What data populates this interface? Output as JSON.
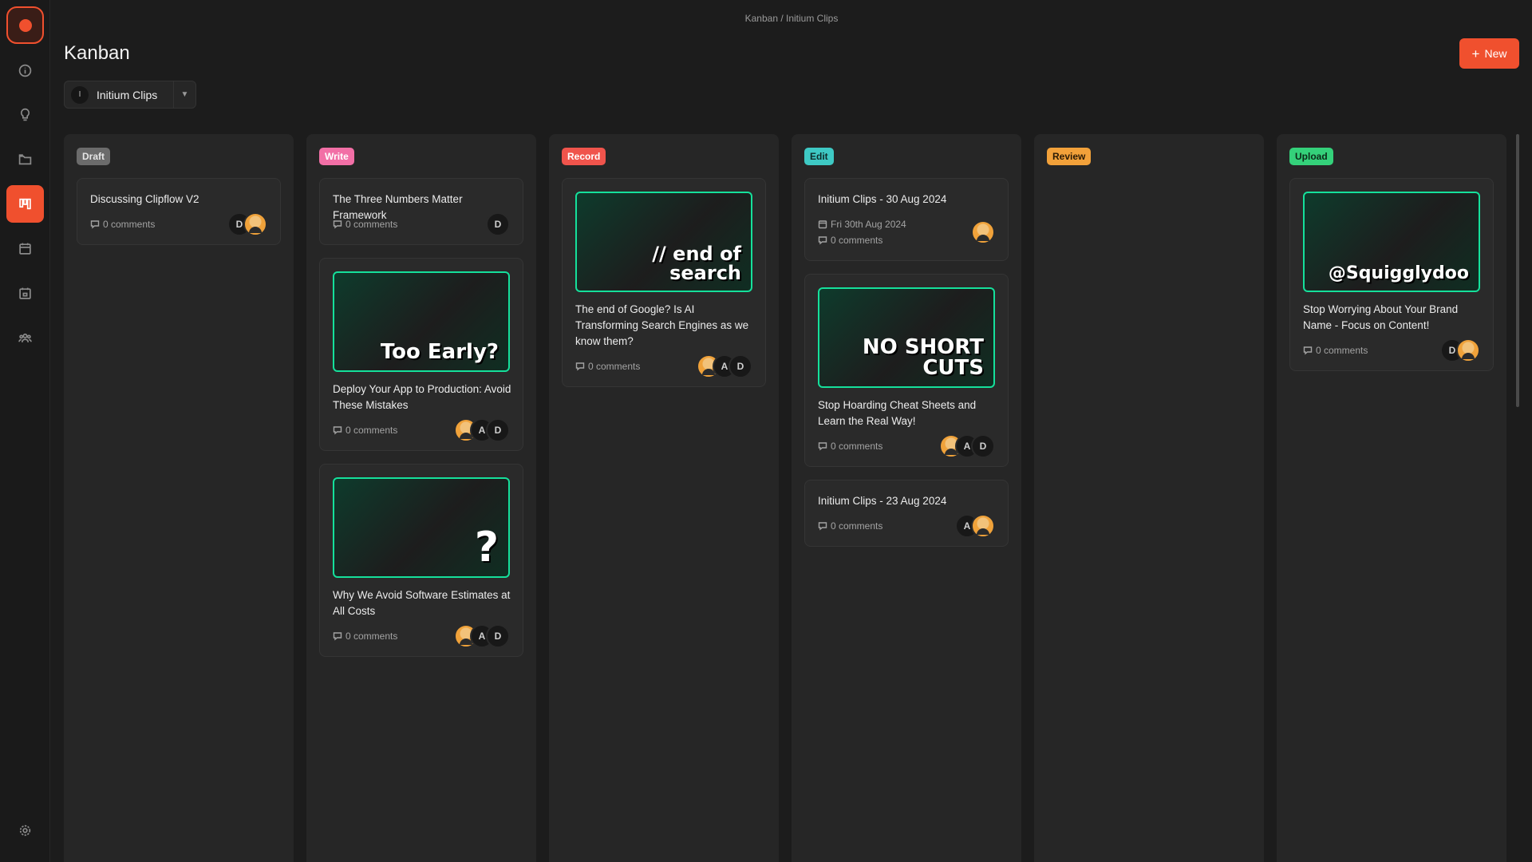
{
  "breadcrumb": "Kanban / Initium Clips",
  "page_title": "Kanban",
  "new_button": "New",
  "project": {
    "initial": "I",
    "name": "Initium Clips"
  },
  "colors": {
    "accent": "#f0502e",
    "thumb_border": "#15e09b"
  },
  "sidebar": {
    "items": [
      {
        "icon": "info-icon"
      },
      {
        "icon": "lightbulb-icon"
      },
      {
        "icon": "folder-icon"
      },
      {
        "icon": "kanban-icon",
        "active": true
      },
      {
        "icon": "calendar-icon"
      },
      {
        "icon": "schedule-icon"
      },
      {
        "icon": "team-icon"
      },
      {
        "icon": "settings-icon"
      }
    ]
  },
  "columns": [
    {
      "label": "Draft",
      "badge_bg": "#6b6b6b",
      "badge_fg": "#e6e6e6",
      "cards": [
        {
          "title": "Discussing Clipflow V2",
          "comments": "0 comments",
          "avatars": [
            "D",
            "photo"
          ]
        }
      ]
    },
    {
      "label": "Write",
      "badge_bg": "#f26fa6",
      "badge_fg": "#ffffff",
      "cards": [
        {
          "title": "The Three Numbers Matter Framework",
          "comments": "0 comments",
          "avatars": [
            "D"
          ]
        },
        {
          "title": "Deploy Your App to Production: Avoid These Mistakes",
          "thumb_text": "Too Early?",
          "comments": "0 comments",
          "avatars": [
            "photo",
            "A",
            "D"
          ]
        },
        {
          "title": "Why We Avoid Software Estimates at All Costs",
          "thumb_text": "?",
          "comments": "0 comments",
          "avatars": [
            "photo",
            "A",
            "D"
          ]
        }
      ]
    },
    {
      "label": "Record",
      "badge_bg": "#f0544c",
      "badge_fg": "#ffffff",
      "cards": [
        {
          "title": "The end of Google? Is AI Transforming Search Engines as we know them?",
          "thumb_text": "// end of search",
          "comments": "0 comments",
          "avatars": [
            "photo",
            "A",
            "D"
          ]
        }
      ]
    },
    {
      "label": "Edit",
      "badge_bg": "#3ec9c4",
      "badge_fg": "#0e2b2a",
      "cards": [
        {
          "title": "Initium Clips - 30 Aug 2024",
          "date": "Fri 30th Aug 2024",
          "comments": "0 comments",
          "avatars": [
            "photo"
          ]
        },
        {
          "title": "Stop Hoarding Cheat Sheets and Learn the Real Way!",
          "thumb_text": "NO SHORT CUTS",
          "comments": "0 comments",
          "avatars": [
            "photo",
            "A",
            "D"
          ]
        },
        {
          "title": "Initium Clips - 23 Aug 2024",
          "comments": "0 comments",
          "avatars": [
            "A",
            "photo"
          ]
        }
      ]
    },
    {
      "label": "Review",
      "badge_bg": "#f2a13a",
      "badge_fg": "#2a1a05",
      "cards": []
    },
    {
      "label": "Upload",
      "badge_bg": "#34d17a",
      "badge_fg": "#0c2a18",
      "cards": [
        {
          "title": "Stop Worrying About Your Brand Name - Focus on Content!",
          "thumb_text": "@Squigglydoo",
          "comments": "0 comments",
          "avatars": [
            "D",
            "photo"
          ]
        }
      ]
    }
  ]
}
